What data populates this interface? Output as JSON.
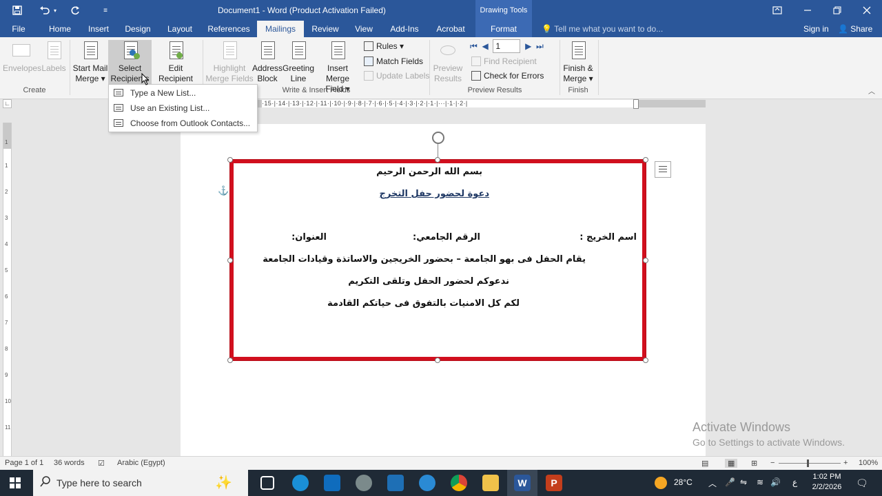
{
  "window": {
    "title": "Document1 - Word (Product Activation Failed)",
    "contextual_tab_group": "Drawing Tools",
    "qat_icons": [
      "save-icon",
      "undo-icon",
      "undo-dropdown-icon",
      "redo-icon",
      "customize-qat-icon"
    ],
    "controls": [
      "ribbon-display-options-icon",
      "minimize-icon",
      "restore-icon",
      "close-icon"
    ]
  },
  "tabs": [
    {
      "label": "File"
    },
    {
      "label": "Home"
    },
    {
      "label": "Insert"
    },
    {
      "label": "Design"
    },
    {
      "label": "Layout"
    },
    {
      "label": "References"
    },
    {
      "label": "Mailings",
      "active": true
    },
    {
      "label": "Review"
    },
    {
      "label": "View"
    },
    {
      "label": "Add-Ins"
    },
    {
      "label": "Acrobat"
    },
    {
      "label": "Format"
    }
  ],
  "tell_me": "Tell me what you want to do...",
  "sign_in": "Sign in",
  "share": "Share",
  "ribbon": {
    "create": {
      "label": "Create",
      "envelopes": "Envelopes",
      "labels": "Labels"
    },
    "start_mail_merge": {
      "label": "Start Mail Merge",
      "start_line1": "Start Mail",
      "start_line2": "Merge",
      "select_line1": "Select",
      "select_line2": "Recipients",
      "edit_line1": "Edit",
      "edit_line2": "Recipient List"
    },
    "write_insert": {
      "label": "Write & Insert Fields",
      "highlight_line1": "Highlight",
      "highlight_line2": "Merge Fields",
      "address_line1": "Address",
      "address_line2": "Block",
      "greeting_line1": "Greeting",
      "greeting_line2": "Line",
      "insert_line1": "Insert Merge",
      "insert_line2": "Field",
      "rules": "Rules",
      "match_fields": "Match Fields",
      "update_labels": "Update Labels"
    },
    "preview": {
      "label": "Preview Results",
      "preview_line1": "Preview",
      "preview_line2": "Results",
      "record": "1",
      "find_recipient": "Find Recipient",
      "check_errors": "Check for Errors"
    },
    "finish": {
      "label": "Finish",
      "line1": "Finish &",
      "line2": "Merge"
    }
  },
  "dropdown": {
    "items": [
      {
        "label": "Type a New List..."
      },
      {
        "label": "Use an Existing List..."
      },
      {
        "label": "Choose from Outlook Contacts..."
      }
    ]
  },
  "ruler": {
    "horizontal_ticks": "·15·|·14·|·13·|·12·|·11·|·10·|·9·|·8·|·7·|·6·|·5·|·4·|·3·|·2·|·1·|···|·1·|·2·|",
    "vertical_numbers": [
      "1",
      "1",
      "2",
      "3",
      "4",
      "5",
      "6",
      "7",
      "8",
      "9",
      "10",
      "11"
    ]
  },
  "document": {
    "line1": "بسم الله الرحمن الرحيم",
    "line2": "دعوة لحضور حفل التخرج",
    "graduate_name": "اسم الخريج :",
    "university_id": "الرقم الجامعي:",
    "address": "العنوان:",
    "line4": "يقام الحفل فى بهو الجامعة – بحضور الخريجين والاساتذة وقيادات الجامعة",
    "line5": "ندعوكم لحضور الحفل وتلقى التكريم",
    "line6": "لكم كل الامنيات بالتفوق فى حياتكم القادمة"
  },
  "activation": {
    "line1": "Activate Windows",
    "line2": "Go to Settings to activate Windows."
  },
  "status": {
    "page": "Page 1 of 1",
    "words": "36 words",
    "language": "Arabic (Egypt)",
    "zoom": "100%",
    "zoom_minus": "−",
    "zoom_plus": "+"
  },
  "taskbar": {
    "search_placeholder": "Type here to search",
    "weather": "28°C",
    "ime": "ع",
    "time": "1:02 PM",
    "date": "2/2/2026",
    "apps": [
      "task-view-icon",
      "edge-icon",
      "outlook-icon",
      "settings-app-icon",
      "calculator-icon",
      "browser-icon",
      "chrome-icon",
      "file-explorer-icon",
      "word-icon",
      "powerpoint-icon"
    ]
  },
  "colors": {
    "word_blue": "#2b579a",
    "textbox_border": "#d10f1e",
    "taskbar": "#1f2a36"
  }
}
